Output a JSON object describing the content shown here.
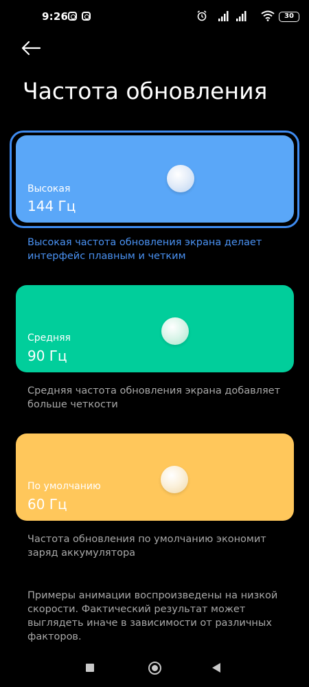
{
  "status_bar": {
    "time": "9:26",
    "battery": "30",
    "icons": [
      "instagram-icon",
      "instagram-icon",
      "alarm-icon",
      "signal-icon",
      "signal-icon",
      "wifi-icon",
      "battery-icon"
    ]
  },
  "header": {
    "back_icon": "back-arrow-icon",
    "title": "Частота обновления"
  },
  "options": [
    {
      "label": "Высокая",
      "value": "144 Гц",
      "description": "Высокая частота обновления экрана делает интерфейс плавным и четким",
      "color": "#5aa7f8",
      "selected": true
    },
    {
      "label": "Средняя",
      "value": "90 Гц",
      "description": "Средняя частота обновления экрана добавляет больше четкости",
      "color": "#01ce9b",
      "selected": false
    },
    {
      "label": "По умолчанию",
      "value": "60 Гц",
      "description": "Частота обновления по умолчанию экономит заряд аккумулятора",
      "color": "#ffc75b",
      "selected": false
    }
  ],
  "footnote": "Примеры анимации воспроизведены на низкой скорости. Фактический результат может выглядеть иначе в зависимости от различных факторов.",
  "colors": {
    "background": "#000000",
    "accent_text": "#4a92f3",
    "secondary_text": "#a9a9a9",
    "selected_border": "#3f8cf1"
  },
  "nav_bar": {
    "icons": [
      "recents-square-icon",
      "home-circle-icon",
      "back-triangle-icon"
    ]
  }
}
